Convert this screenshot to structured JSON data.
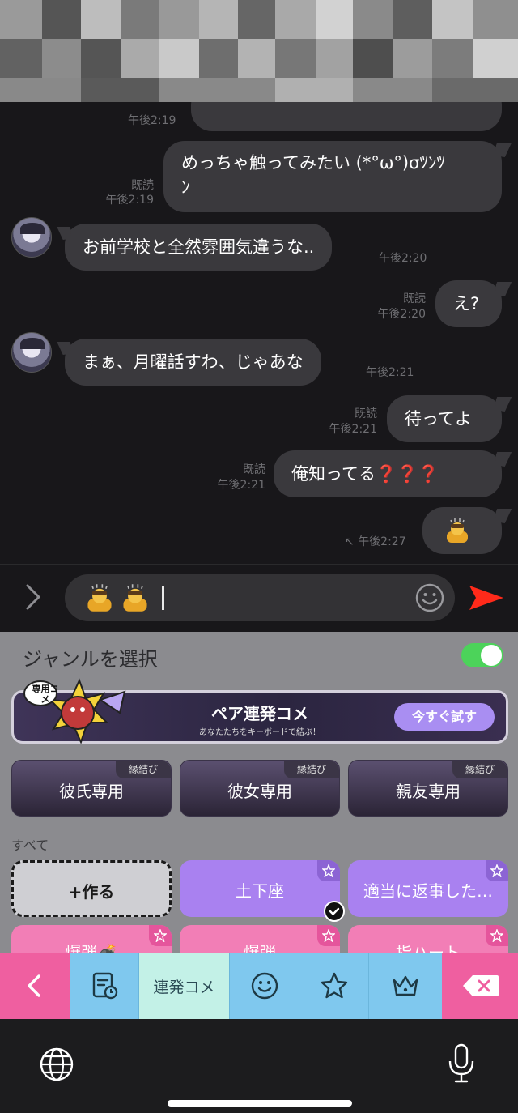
{
  "chat": {
    "partial_time": "午後2:19",
    "messages": [
      {
        "text_line1": "めっちゃ触ってみたい (*°ω°)σﾂﾝﾂ",
        "text_line2": "ﾝ",
        "read": "既読",
        "time": "午後2:19"
      },
      {
        "text": "お前学校と全然雰囲気違うな..",
        "time": "午後2:20"
      },
      {
        "text": "え?",
        "read": "既読",
        "time": "午後2:20"
      },
      {
        "text": "まぁ、月曜話すわ、じゃあな",
        "time": "午後2:21"
      },
      {
        "text": "待ってよ",
        "read": "既読",
        "time": "午後2:21"
      },
      {
        "text": "俺知ってる",
        "emphasis": "❓❓❓",
        "read": "既読",
        "time": "午後2:21"
      },
      {
        "emoji": "bowing-person-emoji",
        "time": "午後2:27"
      }
    ]
  },
  "input": {
    "emojis": [
      "bowing-person-emoji",
      "bowing-person-emoji"
    ],
    "send_color": "#ff2a1a"
  },
  "keyboard_app": {
    "genre_title": "ジャンルを選択",
    "toggle_on": true,
    "banner": {
      "title": "ペア連発コメ",
      "subtitle": "あなたたちをキーボードで結ぶ！",
      "button": "今すぐ試す",
      "badge": "専用コメ"
    },
    "categories": [
      {
        "label": "彼氏専用",
        "tag": "縁結び"
      },
      {
        "label": "彼女専用",
        "tag": "縁結び"
      },
      {
        "label": "親友専用",
        "tag": "縁結び"
      }
    ],
    "all_label": "すべて",
    "tiles": [
      {
        "label": "+作る"
      },
      {
        "label": "土下座"
      },
      {
        "label": "適当に返事した…"
      },
      {
        "label": "爆弾💣"
      },
      {
        "label": "爆弾"
      },
      {
        "label": "指ハート"
      }
    ]
  },
  "toolbar": {
    "active_label": "連発コメ",
    "icons": [
      "chevron-left-icon",
      "history-icon",
      "smiley-icon",
      "star-icon",
      "crown-icon",
      "backspace-icon"
    ]
  },
  "colors": {
    "accent_pink": "#ef5fa0",
    "toolbar_blue": "#7fc8ee",
    "tile_purple": "#a981f0",
    "tile_pink": "#f27eb6",
    "toggle_green": "#4cd35a"
  }
}
